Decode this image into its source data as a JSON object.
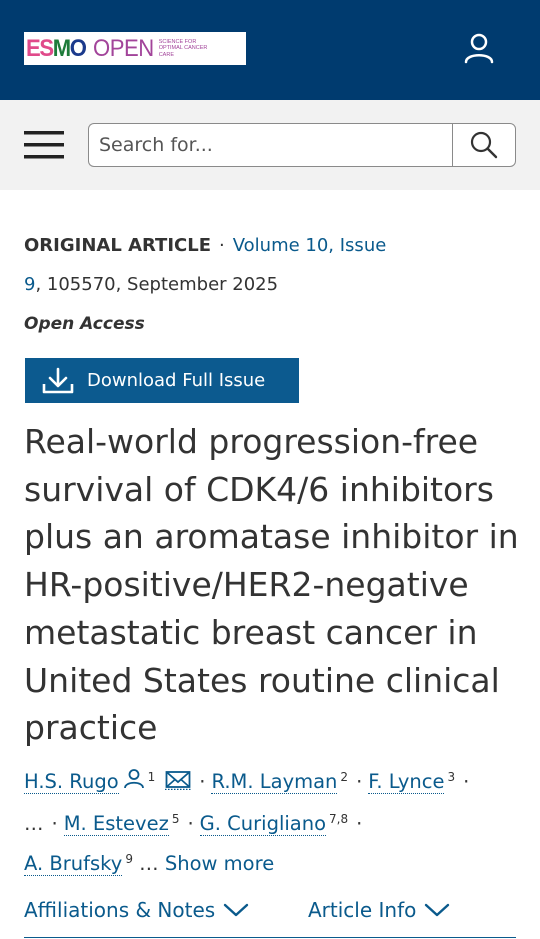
{
  "header": {
    "logo": {
      "part1": "ES",
      "part2": "M",
      "part3": "O",
      "open": "OPEN",
      "tagline": "SCIENCE FOR OPTIMAL CANCER CARE"
    },
    "user_icon": "user-icon"
  },
  "search": {
    "menu_icon": "hamburger-menu-icon",
    "placeholder": "Search for...",
    "button_icon": "search-icon"
  },
  "article": {
    "type": "ORIGINAL ARTICLE",
    "separator": "·",
    "volume_issue_link_1": "Volume 10, Issue",
    "volume_issue_link_2": "9",
    "citation": ", 105570, September 2025",
    "access": "Open Access",
    "download_label": "Download Full Issue",
    "title": "Real-world progression-free survival of CDK4/6 inhibitors plus an aromatase inhibitor in HR-positive/HER2-negative metastatic breast cancer in United States routine clinical practice"
  },
  "authors": {
    "list": [
      {
        "name": "H.S. Rugo",
        "sup": "1"
      },
      {
        "name": "R.M. Layman",
        "sup": "2"
      },
      {
        "name": "F. Lynce",
        "sup": "3"
      },
      {
        "name": "M. Estevez",
        "sup": "5"
      },
      {
        "name": "G. Curigliano",
        "sup": "7,8"
      },
      {
        "name": "A. Brufsky",
        "sup": "9"
      }
    ],
    "ellipsis": "…",
    "show_more": "Show more"
  },
  "tabs": {
    "affiliations": "Affiliations & Notes",
    "article_info": "Article Info"
  },
  "colors": {
    "header_bg": "#003b6f",
    "search_bg": "#f2f2f2",
    "link": "#0a5a8c",
    "button_bg": "#0c5a8f",
    "text": "#333333"
  }
}
